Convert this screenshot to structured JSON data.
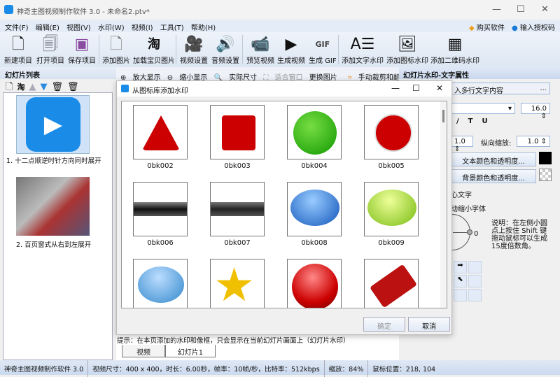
{
  "window": {
    "title": "神奇主图视频制作软件 3.0 - 未命名2.ptv*"
  },
  "menu": [
    "文件(F)",
    "编辑(E)",
    "视图(V)",
    "水印(W)",
    "视频(I)",
    "工具(T)",
    "帮助(H)"
  ],
  "top_links": {
    "buy": "购买软件",
    "license": "输入授权码"
  },
  "toolbar": [
    {
      "label": "新建项目",
      "icon": "new-file-icon"
    },
    {
      "label": "打开项目",
      "icon": "open-file-icon"
    },
    {
      "label": "保存项目",
      "icon": "save-icon"
    },
    {
      "label": "添加图片",
      "icon": "add-image-icon"
    },
    {
      "label": "加载宝贝图片",
      "icon": "taobao-icon"
    },
    {
      "label": "视频设置",
      "icon": "video-camera-icon"
    },
    {
      "label": "音频设置",
      "icon": "audio-icon"
    },
    {
      "label": "预览视频",
      "icon": "preview-icon"
    },
    {
      "label": "生成视频",
      "icon": "video-icon"
    },
    {
      "label": "生成 GIF",
      "icon": "gif-icon"
    },
    {
      "label": "添加文字水印",
      "icon": "text-watermark-icon"
    },
    {
      "label": "添加图标水印",
      "icon": "image-watermark-icon"
    },
    {
      "label": "添加二维码水印",
      "icon": "qrcode-icon"
    }
  ],
  "left": {
    "title": "幻灯片列表",
    "slides": [
      {
        "caption": "1. 十二点顺逆时针方向同时展开"
      },
      {
        "caption": "2. 百页窗式从右到左展开"
      }
    ]
  },
  "center_toolbar": {
    "zoom_in": "放大显示",
    "zoom_out": "缩小显示",
    "actual": "实际尺寸",
    "fit": "适合窗口",
    "replace": "更换图片",
    "crop": "手动裁剪和翻转"
  },
  "right": {
    "title": "幻灯片水印-文字属性",
    "text_input": "入多行文字内容",
    "font_size": "16.0",
    "h_scale": "1.0",
    "v_scale_label": "纵向缩放:",
    "v_scale": "1.0",
    "text_color_btn": "文本颜色和透明度...",
    "bg_color_btn": "背景颜色和透明度...",
    "text_color": "#000000",
    "check1": "心文字",
    "check2": "动缩小字体",
    "angle": "0",
    "note": "说明：在左侧小圆点上按住 Shift 键拖动鼠标可以生成15度倍数角。"
  },
  "dialog": {
    "title": "从图标库添加水印",
    "ok": "确定",
    "cancel": "取消",
    "items": [
      "0bk002",
      "0bk003",
      "0bk004",
      "0bk005",
      "0bk006",
      "0bk007",
      "0bk008",
      "0bk009",
      "",
      "",
      "",
      ""
    ]
  },
  "hint": "提示：在本页添加的水印和像框，只会显示在当前幻灯片画面上（幻灯片水印）",
  "tabs": [
    "视频",
    "幻灯片1"
  ],
  "status": [
    "神奇主图视频制作软件 3.0",
    "视频尺寸：400 x 400，时长：6.00秒，帧率：10帧/秒，比特率：512kbps",
    "缩放：84%",
    "鼠标位置：218, 104"
  ]
}
